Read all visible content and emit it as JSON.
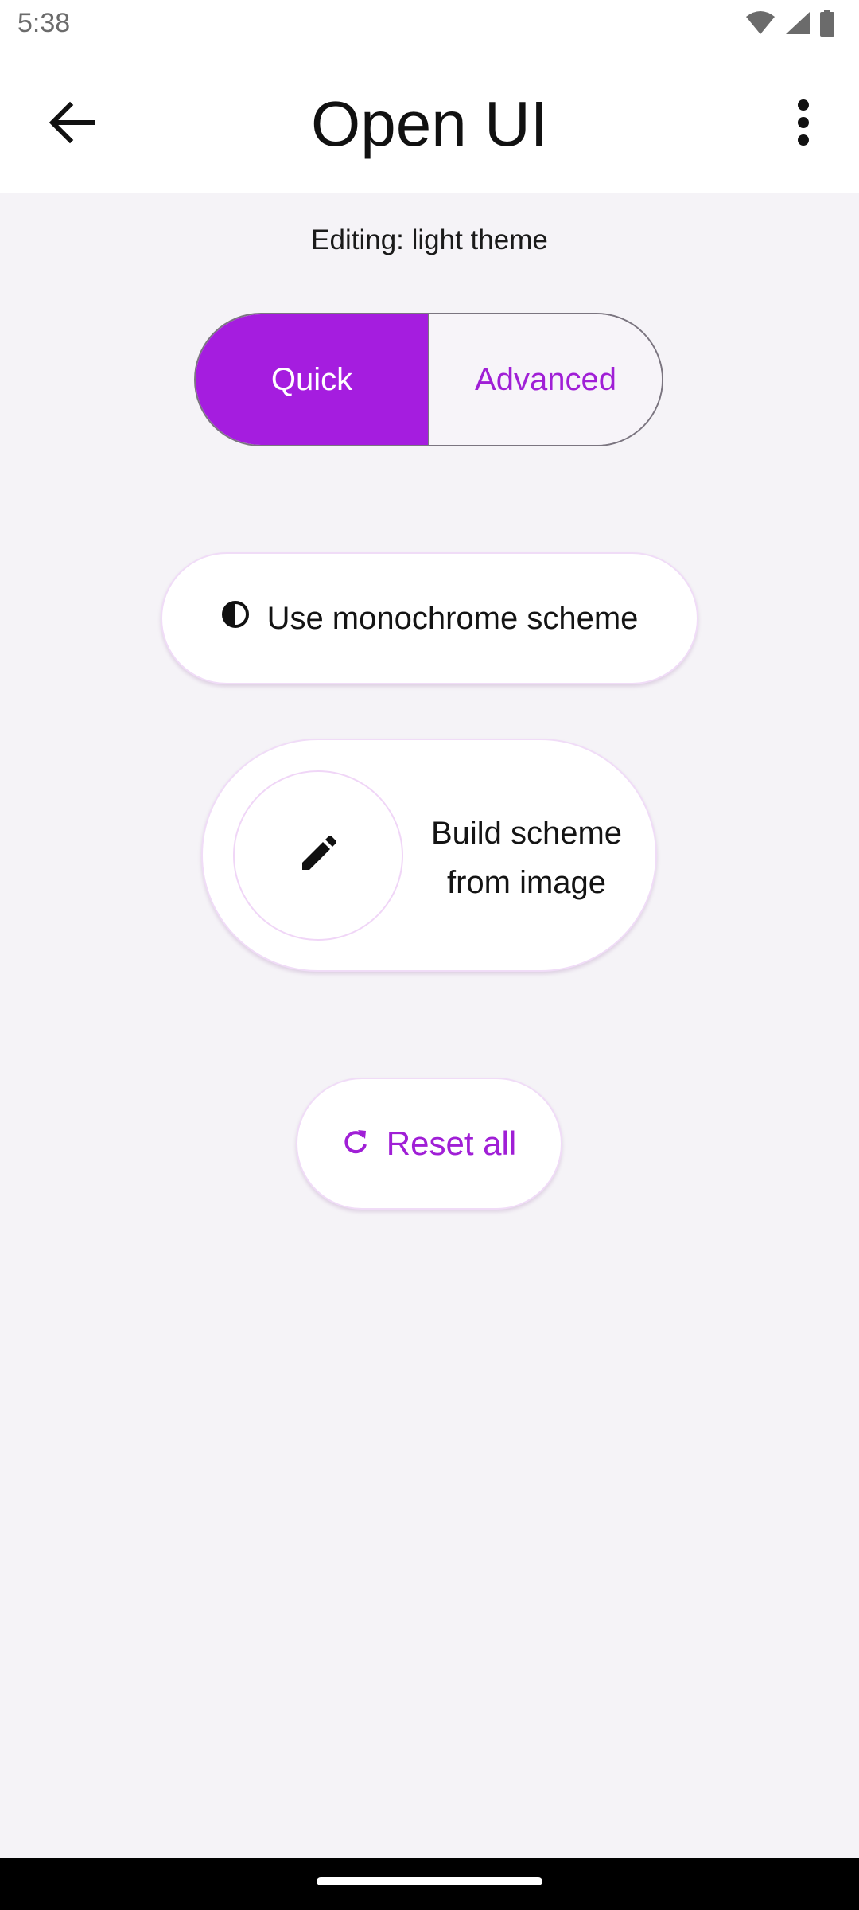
{
  "status_bar": {
    "time": "5:38",
    "icons": [
      "wifi-icon",
      "signal-icon",
      "battery-icon"
    ]
  },
  "app_bar": {
    "title": "Open UI",
    "back_icon": "arrow-back-icon",
    "menu_icon": "more-vert-icon"
  },
  "editing_label": "Editing: light theme",
  "mode_toggle": {
    "options": [
      "Quick",
      "Advanced"
    ],
    "selected": "Quick"
  },
  "actions": {
    "monochrome_label": "Use monochrome scheme",
    "monochrome_icon": "contrast-icon",
    "image_label_line1": "Build scheme",
    "image_label_line2": "from image",
    "image_icon": "edit-pencil-icon",
    "reset_label": "Reset all",
    "reset_icon": "refresh-icon"
  },
  "colors": {
    "accent": "#a51ddf",
    "accent_text": "#a01fd6",
    "background": "#f5f3f7"
  }
}
